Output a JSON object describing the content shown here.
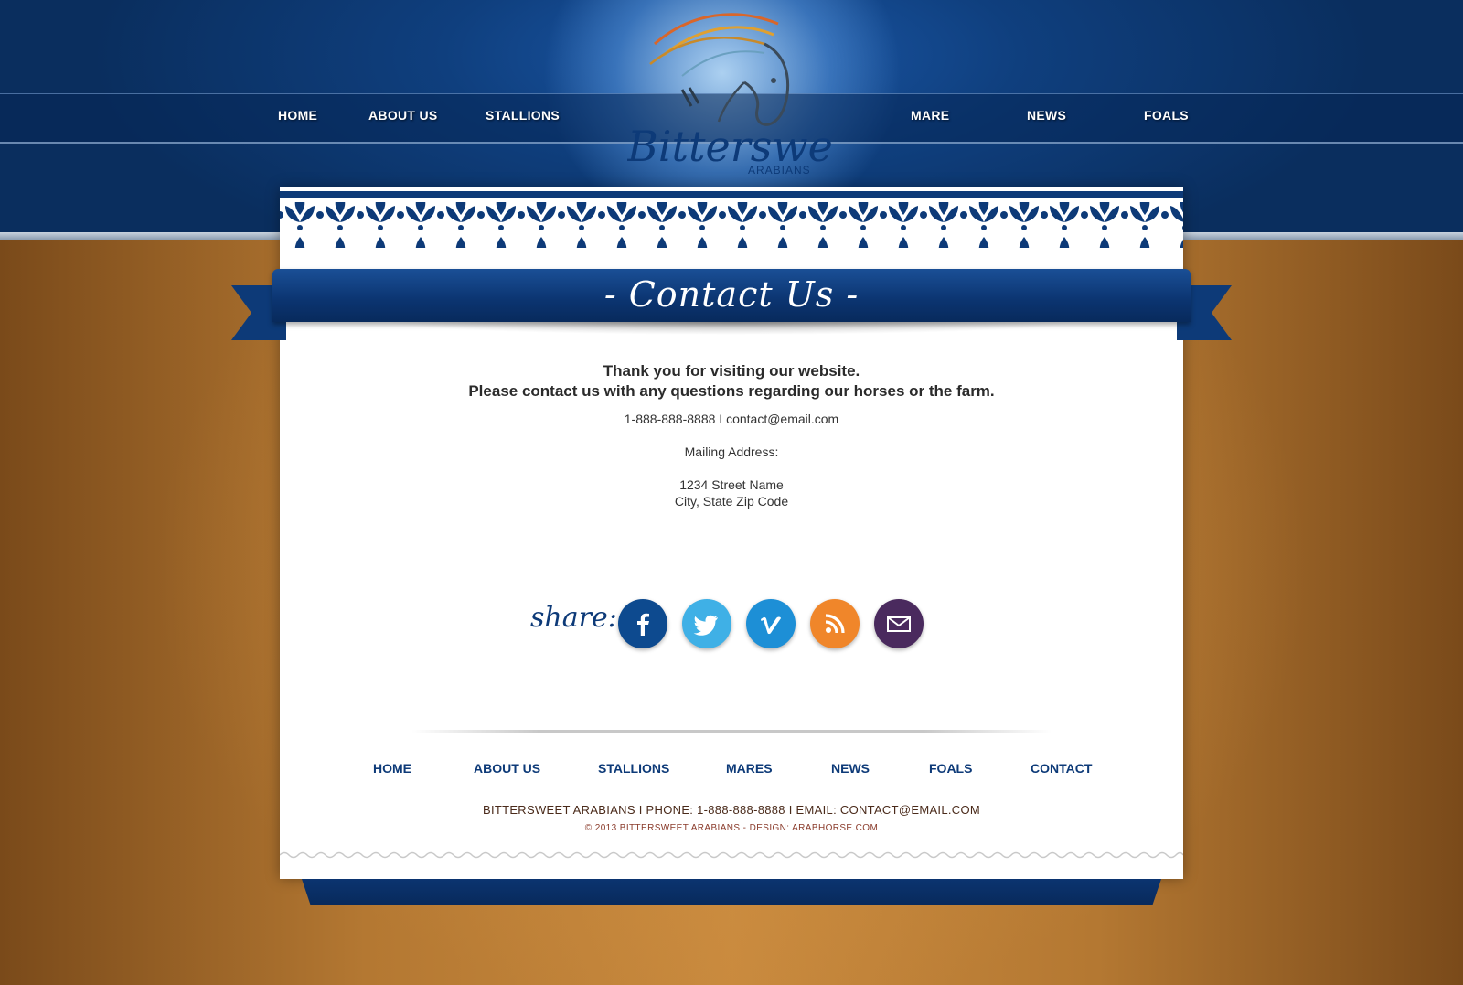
{
  "nav": {
    "left": [
      "HOME",
      "ABOUT US",
      "STALLIONS"
    ],
    "right": [
      "MARE",
      "NEWS",
      "FOALS"
    ]
  },
  "logo": {
    "name": "Bittersweet",
    "sub": "ARABIANS",
    "icon": "horse-head-logo"
  },
  "page": {
    "title": "- Contact Us -"
  },
  "content": {
    "line1": "Thank you for visiting our website.",
    "line2": "Please contact us with any questions regarding our horses or the farm.",
    "contact_line": "1-888-888-8888  I  contact@email.com",
    "mailing_label": "Mailing Address:",
    "street": "1234 Street Name",
    "city": "City, State Zip Code"
  },
  "share": {
    "label": "share:",
    "buttons": [
      {
        "icon": "facebook-icon",
        "color": "#0d4a8f"
      },
      {
        "icon": "twitter-icon",
        "color": "#3fb0e6"
      },
      {
        "icon": "vimeo-icon",
        "color": "#1d8fd6"
      },
      {
        "icon": "rss-icon",
        "color": "#f0862a"
      },
      {
        "icon": "email-icon",
        "color": "#4a2a5e"
      }
    ]
  },
  "footer": {
    "links": [
      "HOME",
      "ABOUT US",
      "STALLIONS",
      "MARES",
      "NEWS",
      "FOALS",
      "CONTACT"
    ],
    "info": "BITTERSWEET ARABIANS  I  PHONE: 1-888-888-8888  I  EMAIL: CONTACT@EMAIL.COM",
    "copyright": "© 2013 BITTERSWEET ARABIANS - DESIGN: ARABHORSE.COM"
  },
  "colors": {
    "navy": "#0d3a78",
    "brown": "#b47832"
  }
}
